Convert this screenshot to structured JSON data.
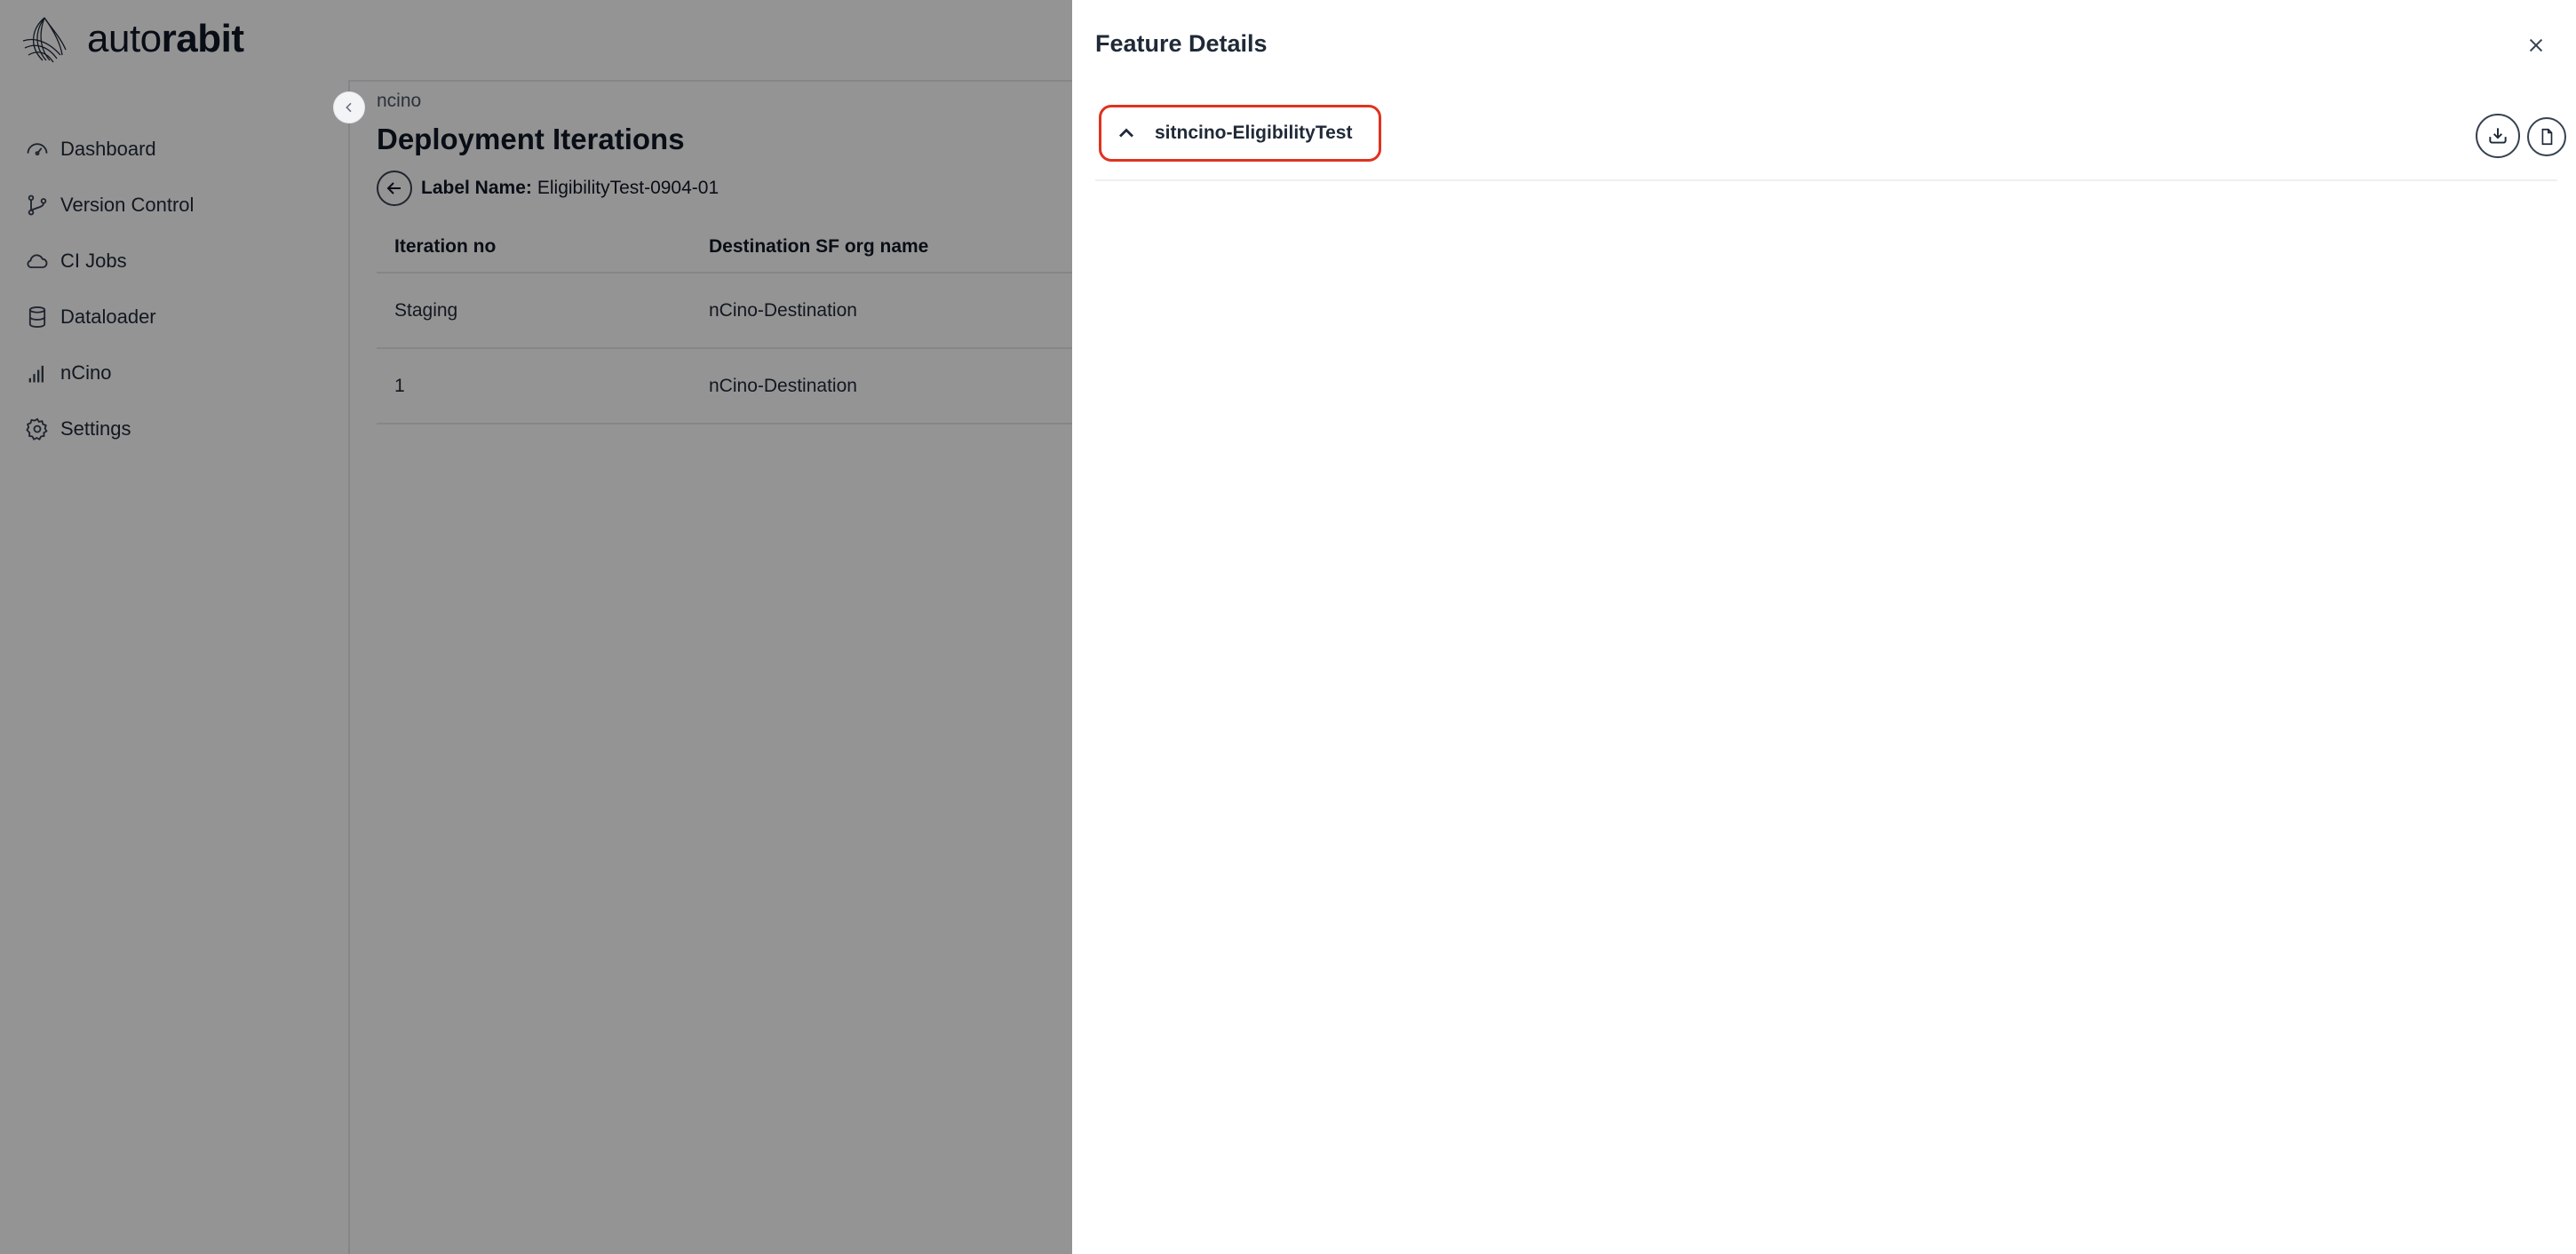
{
  "app": {
    "logo_text_light": "auto",
    "logo_text_bold": "rabit"
  },
  "sidebar": {
    "items": [
      {
        "label": "Dashboard",
        "icon": "dashboard-icon"
      },
      {
        "label": "Version Control",
        "icon": "git-branch-icon"
      },
      {
        "label": "CI Jobs",
        "icon": "cloud-icon"
      },
      {
        "label": "Dataloader",
        "icon": "database-icon"
      },
      {
        "label": "nCino",
        "icon": "signal-bars-icon"
      },
      {
        "label": "Settings",
        "icon": "gear-icon"
      }
    ]
  },
  "main": {
    "breadcrumb": "ncino",
    "title": "Deployment Iterations",
    "label_key": "Label Name:",
    "label_value": "EligibilityTest-0904-01",
    "table": {
      "headers": [
        "Iteration no",
        "Destination SF org name"
      ],
      "rows": [
        [
          "Staging",
          "nCino-Destination"
        ],
        [
          "1",
          "nCino-Destination"
        ]
      ]
    }
  },
  "drawer": {
    "title": "Feature Details",
    "feature_name": "sitncino-EligibilityTest",
    "icons": [
      "chevron-up-icon",
      "download-icon",
      "file-icon",
      "close-icon"
    ]
  },
  "colors": {
    "highlight_border": "#e0321f",
    "overlay": "rgba(0,0,0,0.42)"
  }
}
